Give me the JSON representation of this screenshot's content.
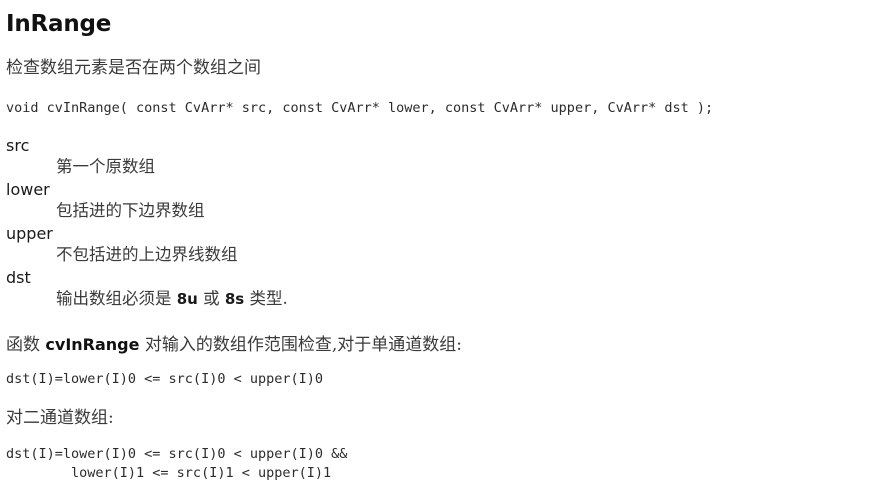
{
  "title": "InRange",
  "summary": "检查数组元素是否在两个数组之间",
  "signature": "void cvInRange( const CvArr* src, const CvArr* lower, const CvArr* upper, CvArr* dst );",
  "parameters": [
    {
      "term": "src",
      "desc": "第一个原数组"
    },
    {
      "term": "lower",
      "desc": "包括进的下边界数组"
    },
    {
      "term": "upper",
      "desc": "不包括进的上边界线数组"
    },
    {
      "term": "dst",
      "desc_prefix": "输出数组必须是 ",
      "code1": "8u",
      "desc_mid": " 或 ",
      "code2": "8s",
      "desc_suffix": " 类型."
    }
  ],
  "description": {
    "lead_prefix": "函数 ",
    "function_name": "cvInRange",
    "lead_suffix": " 对输入的数组作范围检查,对于单通道数组:",
    "formula_single": "dst(I)=lower(I)0 <= src(I)0 < upper(I)0",
    "two_channel_label": "对二通道数组:",
    "formula_multi": "dst(I)=lower(I)0 <= src(I)0 < upper(I)0 &&\n        lower(I)1 <= src(I)1 < upper(I)1"
  },
  "colors": {
    "background": "#ffffff",
    "title_text": "#111111",
    "body_text": "#3a3a3a",
    "code_text": "#2c2c2c"
  }
}
